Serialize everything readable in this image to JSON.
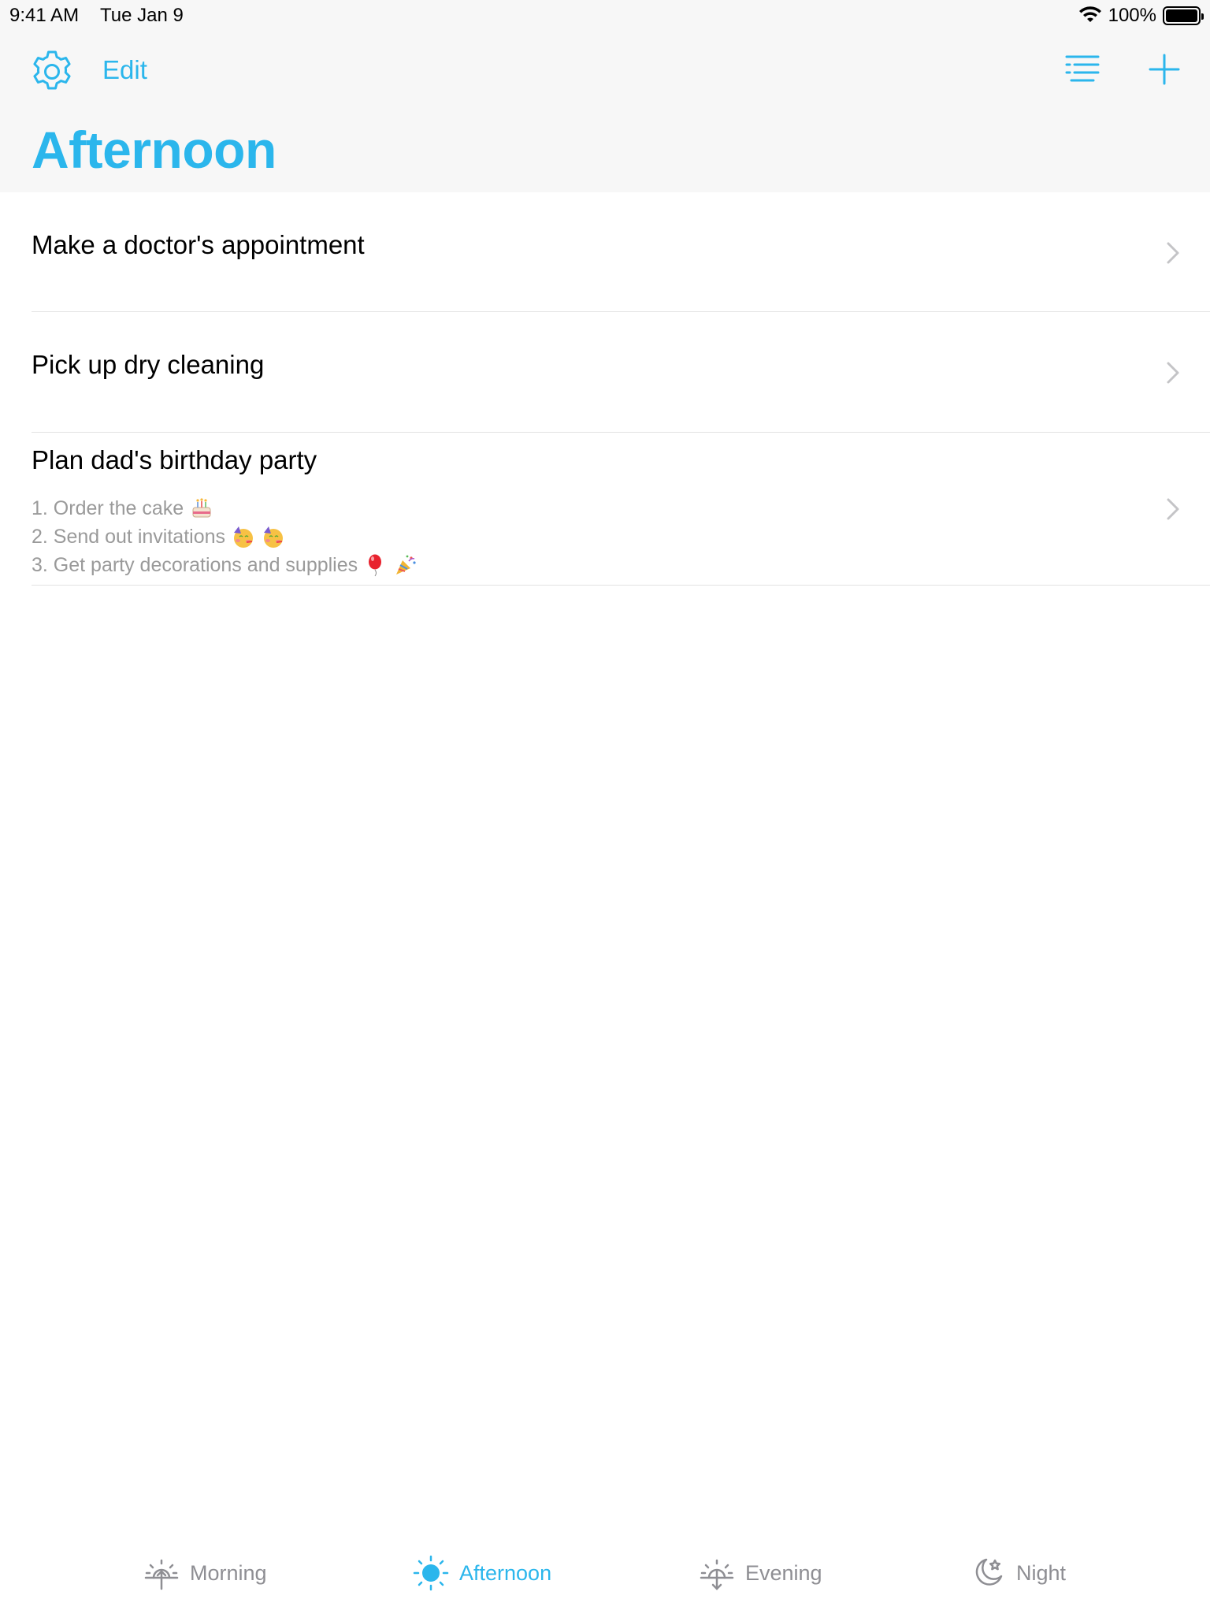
{
  "status_bar": {
    "time": "9:41 AM",
    "date": "Tue Jan 9",
    "battery": "100%",
    "battery_level": 1.0,
    "wifi_icon": "wifi-icon"
  },
  "nav": {
    "settings_icon": "gear-icon",
    "edit_label": "Edit",
    "sort_icon": "list-icon",
    "add_icon": "plus-icon",
    "title": "Afternoon"
  },
  "tasks": [
    {
      "title": "Make a doctor's appointment",
      "notes": []
    },
    {
      "title": "Pick up dry cleaning",
      "notes": []
    },
    {
      "title": "Plan dad's birthday party",
      "notes": [
        {
          "text": "1. Order the cake",
          "emojis": [
            "birthday-cake-emoji"
          ]
        },
        {
          "text": "2. Send out invitations",
          "emojis": [
            "partying-face-emoji",
            "partying-face-emoji"
          ]
        },
        {
          "text": "3. Get party decorations and supplies",
          "emojis": [
            "balloon-emoji",
            "party-popper-emoji"
          ]
        }
      ]
    }
  ],
  "tabs": [
    {
      "label": "Morning",
      "icon": "sunrise-icon",
      "active": false
    },
    {
      "label": "Afternoon",
      "icon": "sun-icon",
      "active": true
    },
    {
      "label": "Evening",
      "icon": "sunset-icon",
      "active": false
    },
    {
      "label": "Night",
      "icon": "moon-star-icon",
      "active": false
    }
  ],
  "colors": {
    "accent": "#2bb6ec",
    "inactive": "#8e8e93",
    "note_text": "#9a9a9a",
    "separator": "#e3e3e3",
    "header_bg": "#f7f7f7"
  }
}
